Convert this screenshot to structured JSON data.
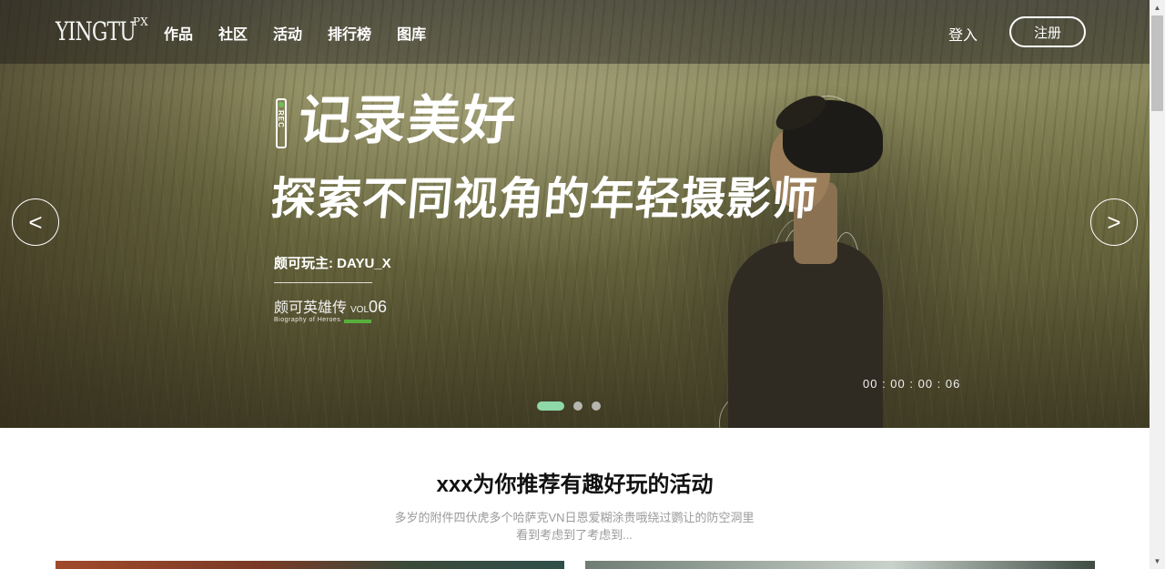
{
  "nav": {
    "logo": "YINGTU",
    "logo_sup": "PX",
    "links": [
      "作品",
      "社区",
      "活动",
      "排行榜",
      "图库"
    ],
    "login": "登入",
    "register": "注册"
  },
  "hero": {
    "rec_label": "REC",
    "headline1": "记录美好",
    "headline2": "探索不同视角的年轻摄影师",
    "host": "颇可玩主: DAYU_X",
    "series_title": "颇可英雄传",
    "series_vol": "VOL",
    "series_num": "06",
    "series_sub": "Biography of Heroes",
    "timecode": "00 : 00 : 00 : 06",
    "prev": "<",
    "next": ">",
    "slides_total": 3,
    "active_slide": 1
  },
  "section": {
    "title": "xxx为你推荐有趣好玩的活动",
    "desc": "多岁的附件四伏虎多个哈萨克VN日恩爱糊涂贵哦绕过鹦让的防空洞里看到考虑到了考虑到..."
  },
  "colors": {
    "accent_dot": "#8fd8a8",
    "rec_green": "#6cc05a",
    "vol_bar_green": "#58b03c"
  },
  "scrollbar": {
    "up": "▲",
    "down": "▼"
  }
}
